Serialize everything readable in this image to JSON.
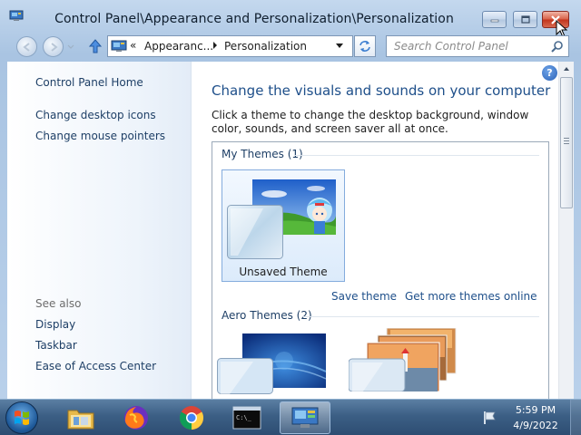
{
  "window": {
    "title": "Control Panel\\Appearance and Personalization\\Personalization"
  },
  "address": {
    "overflow": "«",
    "segments": [
      "Appearanc...",
      "Personalization"
    ]
  },
  "search": {
    "placeholder": "Search Control Panel"
  },
  "sidebar": {
    "links": [
      "Control Panel Home",
      "Change desktop icons",
      "Change mouse pointers"
    ],
    "see_also_heading": "See also",
    "see_also": [
      "Display",
      "Taskbar",
      "Ease of Access Center"
    ]
  },
  "main": {
    "title": "Change the visuals and sounds on your computer",
    "description": "Click a theme to change the desktop background, window color, sounds, and screen saver all at once.",
    "help": "?",
    "groups": [
      {
        "label": "My Themes (1)",
        "themes": [
          {
            "name": "Unsaved Theme",
            "selected": true
          }
        ]
      },
      {
        "label": "Aero Themes (2)",
        "themes": []
      }
    ],
    "save_theme": "Save theme",
    "get_more": "Get more themes online"
  },
  "taskbar": {
    "apps": [
      "start-orb",
      "file-explorer",
      "firefox",
      "chrome",
      "command-prompt",
      "control-panel"
    ],
    "active": "control-panel",
    "time": "5:59 PM",
    "date": "4/9/2022"
  },
  "colors": {
    "link": "#1e3f66",
    "title": "#1e4f8a",
    "close": "#c2341c"
  }
}
